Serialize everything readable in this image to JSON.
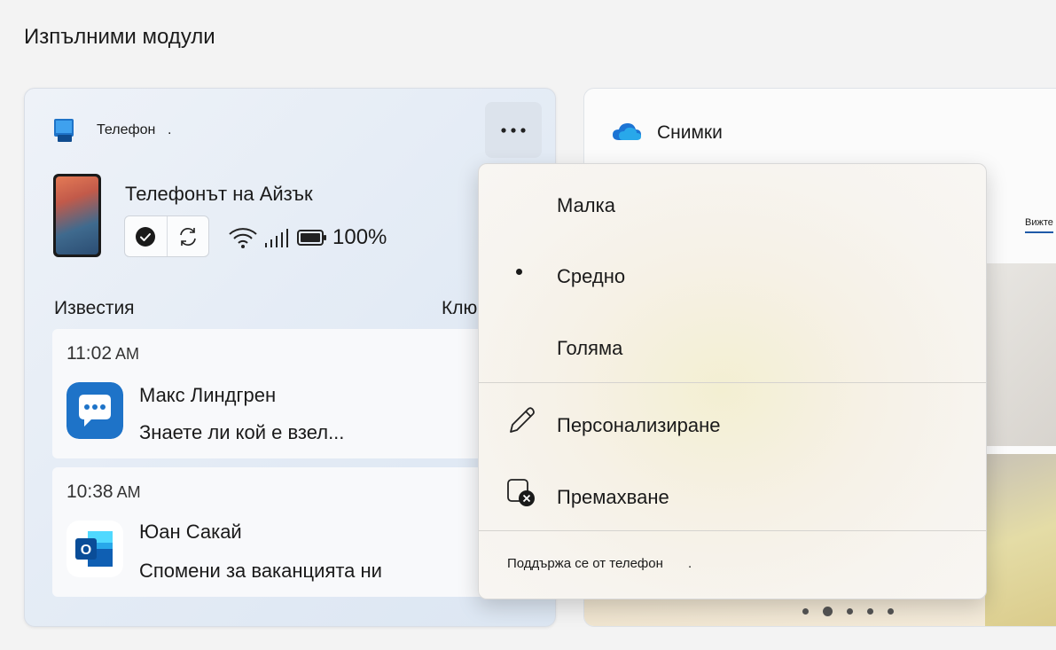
{
  "page_title": "Изпълними модули",
  "phone_widget": {
    "app_name": "Телефон",
    "app_name_suffix": ".",
    "phone_name": "Телефонът на Айзък",
    "battery": "100%",
    "notifications_label": "Известия",
    "key_label": "Ключ",
    "notifications": [
      {
        "time": "11:02",
        "ampm": "AM",
        "sender": "Макс Линдгрен",
        "message": "Знаете ли кой е взел..."
      },
      {
        "time": "10:38",
        "ampm": "AM",
        "sender": "Юан Сакай",
        "message": "Спомени за ваканцията ни"
      }
    ]
  },
  "photos_widget": {
    "title": "Снимки",
    "see_tab": "Вижте"
  },
  "menu": {
    "size_small": "Малка",
    "size_medium": "Средно",
    "size_large": "Голяма",
    "selected": "Средно",
    "customize": "Персонализиране",
    "remove": "Премахване",
    "footer": "Поддържа се от телефон",
    "footer_suffix": "."
  },
  "colors": {
    "accent": "#1f5aa8",
    "chat_icon": "#1e73c8",
    "outlook_blue": "#0f5fb3"
  }
}
